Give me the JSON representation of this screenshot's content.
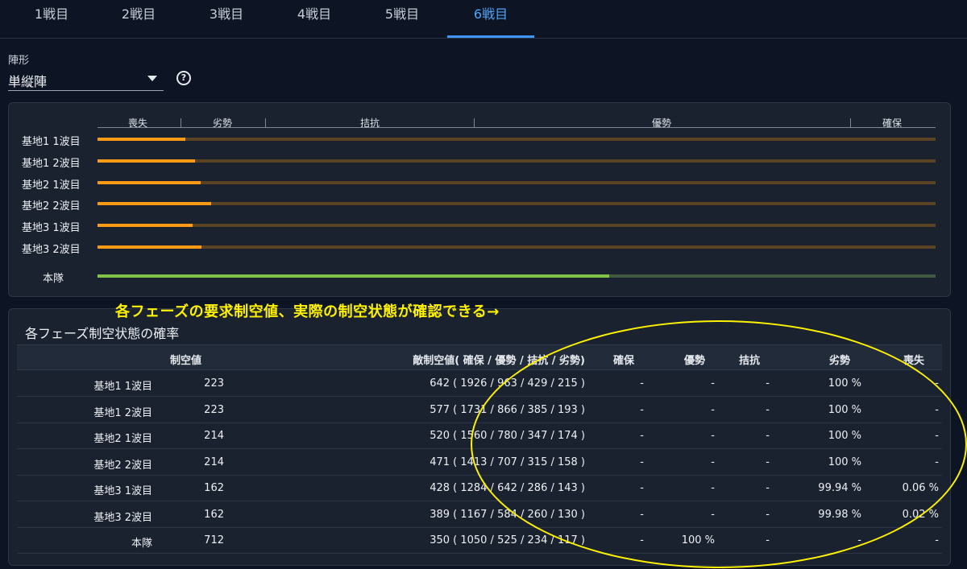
{
  "tabs": [
    "1戦目",
    "2戦目",
    "3戦目",
    "4戦目",
    "5戦目",
    "6戦目"
  ],
  "active_tab": 5,
  "formation": {
    "label": "陣形",
    "value": "単縦陣"
  },
  "help_icon": "?",
  "air_bar": {
    "headers": [
      "喪失",
      "劣勢",
      "拮抗",
      "優勢",
      "確保"
    ],
    "rows": [
      {
        "label": "基地1 1波目",
        "fill": 0.105
      },
      {
        "label": "基地1 2波目",
        "fill": 0.116
      },
      {
        "label": "基地2 1波目",
        "fill": 0.123
      },
      {
        "label": "基地2 2波目",
        "fill": 0.136
      },
      {
        "label": "基地3 1波目",
        "fill": 0.113
      },
      {
        "label": "基地3 2波目",
        "fill": 0.124
      }
    ],
    "main": {
      "label": "本隊",
      "fill": 0.611
    },
    "colors": {
      "base_fill": "#ff9a16",
      "base_track": "#5a4322",
      "main_fill": "#7fc446",
      "main_track": "#3f5a41"
    }
  },
  "annotation": "各フェーズの要求制空値、実際の制空状態が確認できる→",
  "table": {
    "title": "各フェーズ制空状態の確率",
    "columns": [
      "",
      "制空値",
      "敵制空値( 確保 / 優勢 / 拮抗 / 劣勢)",
      "確保",
      "優勢",
      "拮抗",
      "劣勢",
      "喪失"
    ],
    "rows": [
      [
        "基地1 1波目",
        "223",
        "642 ( 1926 / 963 / 429 / 215 )",
        "-",
        "-",
        "-",
        "100 %",
        "-"
      ],
      [
        "基地1 2波目",
        "223",
        "577 ( 1731 / 866 / 385 / 193 )",
        "-",
        "-",
        "-",
        "100 %",
        "-"
      ],
      [
        "基地2 1波目",
        "214",
        "520 ( 1560 / 780 / 347 / 174 )",
        "-",
        "-",
        "-",
        "100 %",
        "-"
      ],
      [
        "基地2 2波目",
        "214",
        "471 ( 1413 / 707 / 315 / 158 )",
        "-",
        "-",
        "-",
        "100 %",
        "-"
      ],
      [
        "基地3 1波目",
        "162",
        "428 ( 1284 / 642 / 286 / 143 )",
        "-",
        "-",
        "-",
        "99.94 %",
        "0.06 %"
      ],
      [
        "基地3 2波目",
        "162",
        "389 ( 1167 / 584 / 260 / 130 )",
        "-",
        "-",
        "-",
        "99.98 %",
        "0.02 %"
      ],
      [
        "本隊",
        "712",
        "350 ( 1050 / 525 / 234 / 117 )",
        "-",
        "100 %",
        "-",
        "-",
        "-"
      ]
    ]
  }
}
